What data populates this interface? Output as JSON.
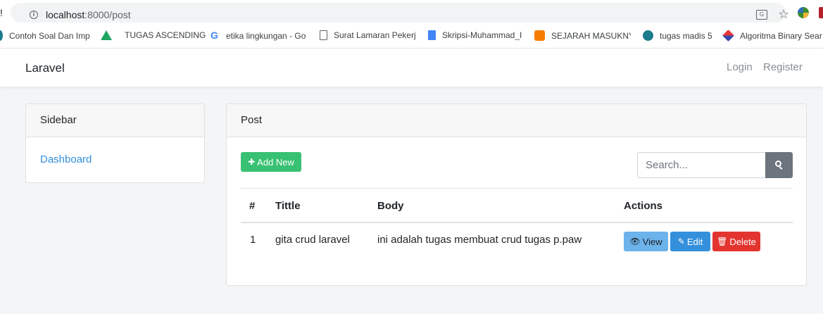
{
  "browser": {
    "url_host": "localhost",
    "url_path": ":8000/post",
    "bookmarks": [
      {
        "label": "Contoh Soal Dan Imp",
        "icon": "globe-icon"
      },
      {
        "label": "TUGAS ASCENDING |",
        "icon": "google-drive-icon"
      },
      {
        "label": "etika lingkungan - Go",
        "icon": "google-icon"
      },
      {
        "label": "Surat Lamaran Pekerj",
        "icon": "document-icon"
      },
      {
        "label": "Skripsi-Muhammad_I",
        "icon": "google-docs-icon"
      },
      {
        "label": "SEJARAH MASUKNYA",
        "icon": "blogger-icon"
      },
      {
        "label": "tugas madis 5",
        "icon": "globe-icon"
      },
      {
        "label": "Algoritma Binary Sear",
        "icon": "diamond-icon"
      }
    ]
  },
  "navbar": {
    "brand": "Laravel",
    "login": "Login",
    "register": "Register"
  },
  "sidebar": {
    "title": "Sidebar",
    "items": [
      {
        "label": "Dashboard"
      }
    ]
  },
  "post": {
    "title": "Post",
    "add_new_label": "Add New",
    "search": {
      "placeholder": "Search..."
    },
    "columns": [
      "#",
      "Tittle",
      "Body",
      "Actions"
    ],
    "rows": [
      {
        "no": "1",
        "title": "gita crud laravel",
        "body": "ini adalah tugas membuat crud tugas p.paw"
      }
    ],
    "actions": {
      "view": "View",
      "edit": "Edit",
      "delete": "Delete"
    }
  },
  "colors": {
    "success": "#38c172",
    "info": "#6cb2eb",
    "primary": "#3490dc",
    "danger": "#e3342f",
    "secondary": "#6c757d",
    "link": "#3490dc"
  }
}
